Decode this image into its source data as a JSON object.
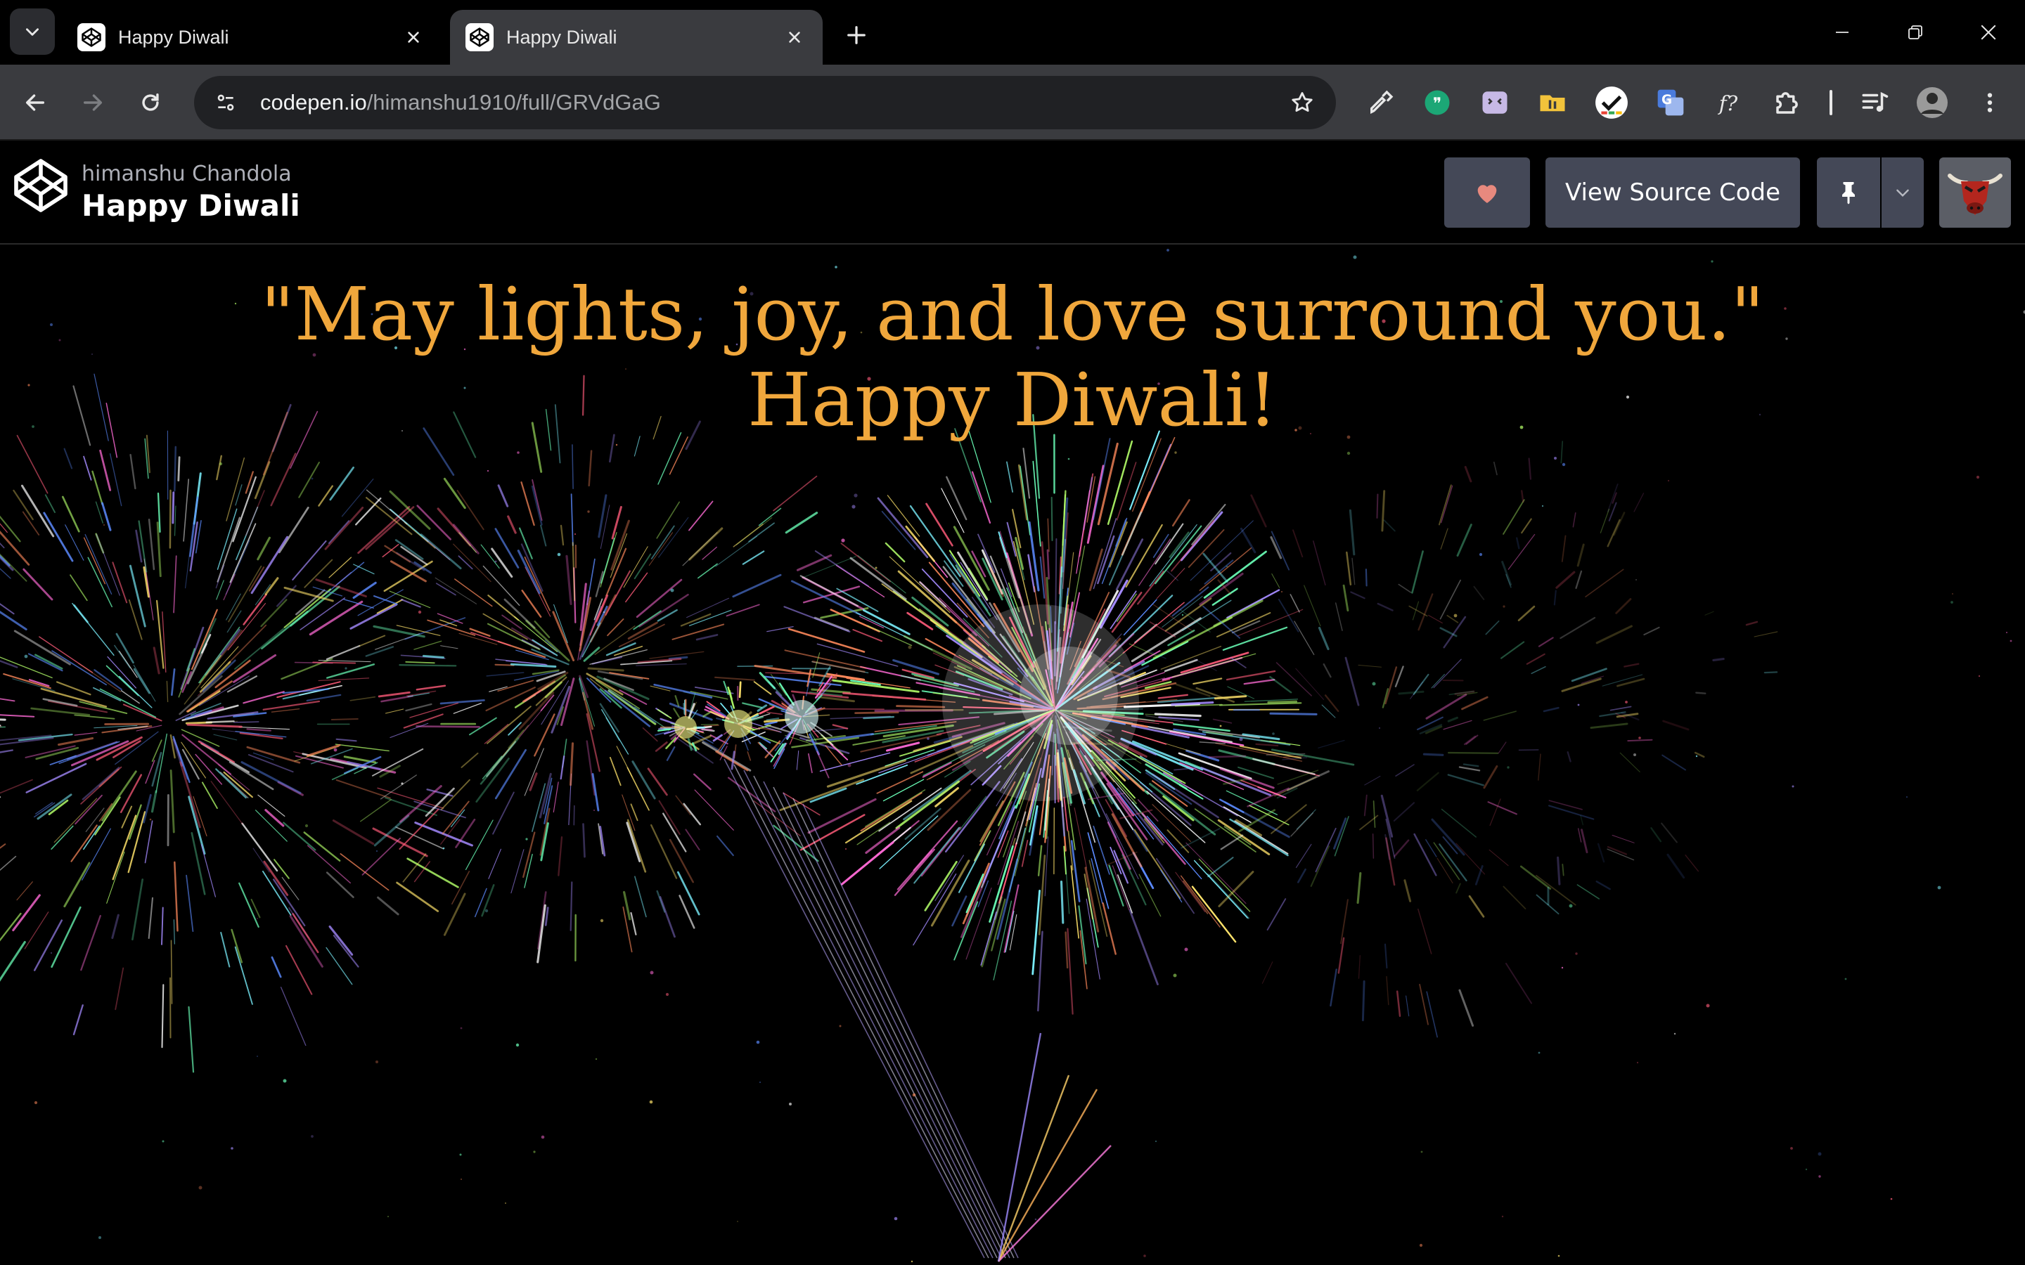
{
  "browser": {
    "tabs": [
      {
        "title": "Happy Diwali",
        "active": false
      },
      {
        "title": "Happy Diwali",
        "active": true
      }
    ],
    "address": {
      "host": "codepen.io",
      "path": "/himanshu1910/full/GRVdGaG"
    },
    "extensions": [
      "eyedropper-icon",
      "quote-icon",
      "hex-face-icon",
      "folder-icon",
      "checkmark-icon",
      "translate-icon",
      "function-icon",
      "puzzle-icon",
      "media-playlist-icon",
      "profile-icon"
    ]
  },
  "codepen": {
    "author": "himanshu Chandola",
    "title": "Happy Diwali",
    "view_source_label": "View Source Code"
  },
  "content": {
    "quote": "\"May lights, joy, and love surround you.\"",
    "wish": "Happy Diwali!"
  },
  "colors": {
    "greeting": "#f0a73c",
    "heart": "#e8897e",
    "button_bg": "#444857"
  }
}
